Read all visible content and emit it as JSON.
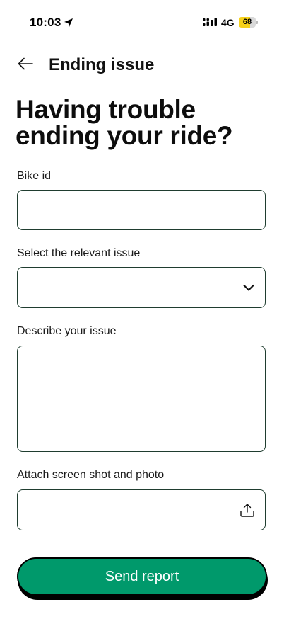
{
  "status_bar": {
    "time": "10:03",
    "network": "4G",
    "battery_level": "68",
    "battery_fraction": 0.68,
    "battery_color": "#f7d21a",
    "icons": [
      "location-arrow-icon",
      "signal-icon",
      "battery-icon"
    ]
  },
  "header": {
    "back_icon": "arrow-left-icon",
    "title": "Ending issue"
  },
  "headline": {
    "line1": "Having trouble",
    "line2": "ending your ride?"
  },
  "form": {
    "bike_id": {
      "label": "Bike id",
      "value": "",
      "placeholder": ""
    },
    "issue_select": {
      "label": "Select the relevant issue",
      "selected": "",
      "icon": "chevron-down-icon"
    },
    "description": {
      "label": "Describe your issue",
      "value": "",
      "placeholder": ""
    },
    "attachment": {
      "label": "Attach screen shot and photo",
      "value": "",
      "icon": "upload-icon"
    }
  },
  "actions": {
    "send_label": "Send report",
    "accent_color": "#00996b"
  }
}
